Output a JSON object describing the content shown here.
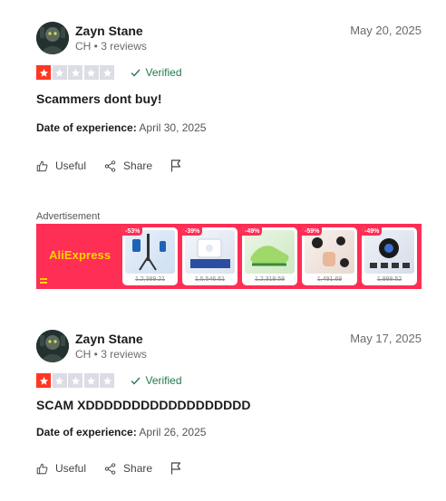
{
  "reviews": [
    {
      "name": "Zayn Stane",
      "meta": "CH • 3 reviews",
      "date": "May 20, 2025",
      "rating": 1,
      "verified": "Verified",
      "title": "Scammers dont buy!",
      "experience_label": "Date of experience:",
      "experience_date": "April 30, 2025",
      "useful": "Useful",
      "share": "Share"
    },
    {
      "name": "Zayn Stane",
      "meta": "CH • 3 reviews",
      "date": "May 17, 2025",
      "rating": 1,
      "verified": "Verified",
      "title": "SCAM XDDDDDDDDDDDDDDDDDD",
      "experience_label": "Date of experience:",
      "experience_date": "April 26, 2025",
      "useful": "Useful",
      "share": "Share"
    }
  ],
  "ad": {
    "label": "Advertisement",
    "brand": "AliExpress",
    "products": [
      {
        "badge": "-53%",
        "price": "1,2,389.21"
      },
      {
        "badge": "-39%",
        "price": "1,5,546.61"
      },
      {
        "badge": "-49%",
        "price": "1,2,319.58"
      },
      {
        "badge": "-59%",
        "price": "1,491.69"
      },
      {
        "badge": "-49%",
        "price": "1,988.52"
      }
    ]
  },
  "colors": {
    "star_on": "#ff3722",
    "star_off": "#dcdce6",
    "verified": "#1f7a4a",
    "ad_bg": "#ff2e55"
  }
}
